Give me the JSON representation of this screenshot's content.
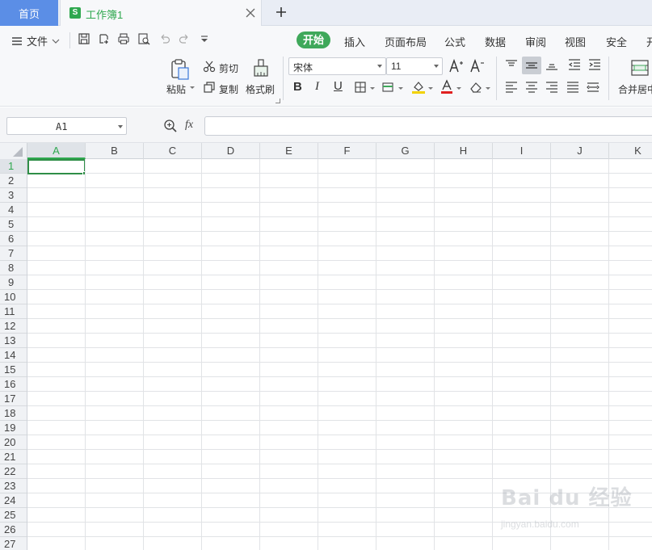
{
  "tabs": {
    "home_label": "首页",
    "doc_icon": "S",
    "doc_label": "工作簿1",
    "add_icon": "plus-icon"
  },
  "toolbar": {
    "file_label": "文件",
    "ribbon_tabs": [
      "开始",
      "插入",
      "页面布局",
      "公式",
      "数据",
      "审阅",
      "视图",
      "安全",
      "开"
    ],
    "active_tab": "开始",
    "paste_label": "粘贴",
    "cut_label": "剪切",
    "copy_label": "复制",
    "format_painter_label": "格式刷",
    "font_name": "宋体",
    "font_size": "11",
    "merge_label": "合并居中"
  },
  "formula_bar": {
    "name_box": "A1",
    "fx_label": "fx",
    "formula_value": ""
  },
  "sheet": {
    "columns": [
      "A",
      "B",
      "C",
      "D",
      "E",
      "F",
      "G",
      "H",
      "I",
      "J",
      "K"
    ],
    "rows": [
      "1",
      "2",
      "3",
      "4",
      "5",
      "6",
      "7",
      "8",
      "9",
      "10",
      "11",
      "12",
      "13",
      "14",
      "15",
      "16",
      "17",
      "18",
      "19",
      "20",
      "21",
      "22",
      "23",
      "24",
      "25",
      "26",
      "27"
    ],
    "active_cell": "A1",
    "active_color": "#2fa84f"
  },
  "watermark": {
    "brand": "Bai du 经验",
    "url": "jingyan.baidu.com"
  }
}
